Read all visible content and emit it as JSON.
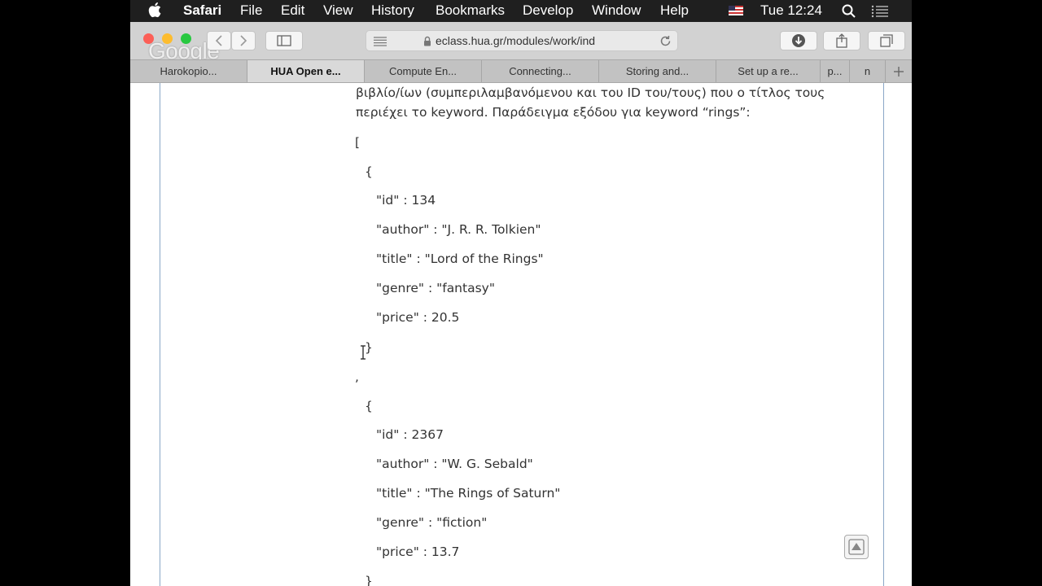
{
  "menubar": {
    "app": "Safari",
    "items": [
      "File",
      "Edit",
      "View",
      "History",
      "Bookmarks",
      "Develop",
      "Window",
      "Help"
    ],
    "clock": "Tue 12:24"
  },
  "toolbar": {
    "overlay_logo": "Google",
    "url": "eclass.hua.gr/modules/work/ind"
  },
  "tabs": [
    {
      "label": "Harokopio..."
    },
    {
      "label": "HUA Open e..."
    },
    {
      "label": "Compute En..."
    },
    {
      "label": "Connecting..."
    },
    {
      "label": "Storing and..."
    },
    {
      "label": "Set up a re..."
    },
    {
      "label": "p..."
    },
    {
      "label": "n"
    }
  ],
  "content": {
    "intro_line1": "βιβλίο/ίων (συμπεριλαμβανόμενου και του ID του/τους) που ο τίτλος τους",
    "intro_line2": "περιέχει το keyword. Παράδειγμα εξόδου για keyword “rings”:",
    "open_bracket": "[",
    "open_brace": "{",
    "close_brace": "}",
    "comma": ",",
    "books": [
      {
        "id": "\"id\" : 134",
        "author": "\"author\" : \"J. R. R. Tolkien\"",
        "title": "\"title\" : \"Lord of the Rings\"",
        "genre": "\"genre\" : \"fantasy\"",
        "price": "\"price\" : 20.5"
      },
      {
        "id": "\"id\" : 2367",
        "author": "\"author\" : \"W. G. Sebald\"",
        "title": "\"title\" : \"The Rings of Saturn\"",
        "genre": "\"genre\" : \"fiction\"",
        "price": "\"price\" : 13.7"
      }
    ]
  },
  "colors": {
    "menubar_bg": "#1f1f1f",
    "traffic_close": "#fc5f57",
    "traffic_min": "#fdbc2e",
    "traffic_max": "#28c840",
    "frame_border": "#8aa7c7"
  }
}
